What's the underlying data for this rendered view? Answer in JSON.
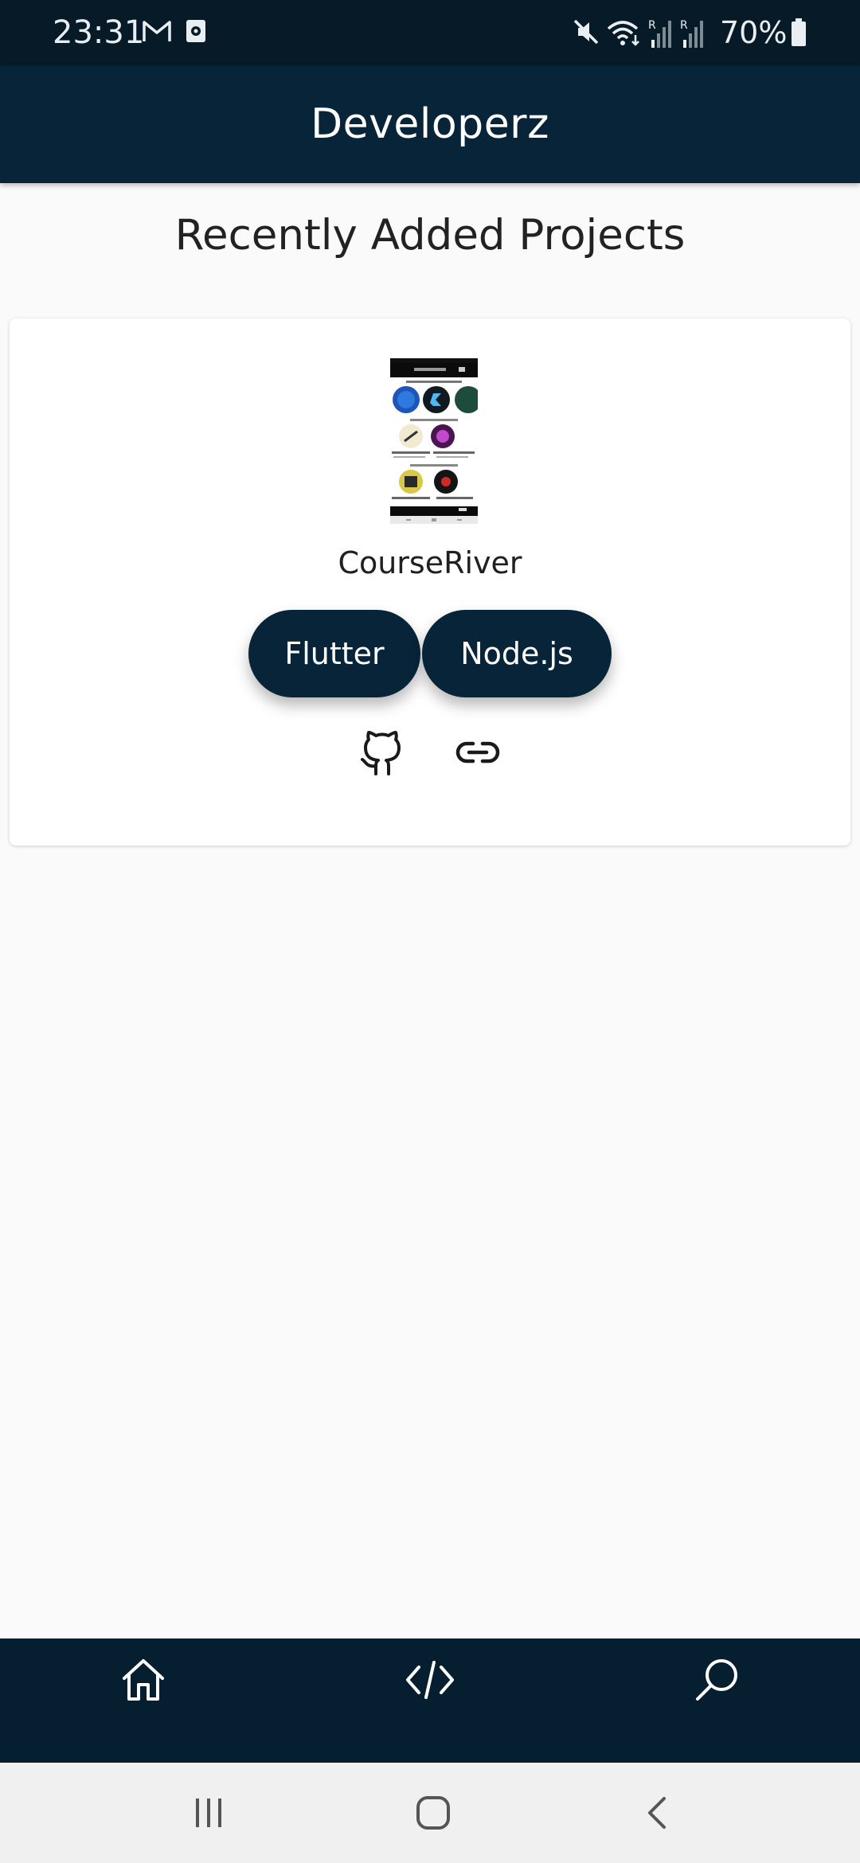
{
  "status_bar": {
    "time": "23:31",
    "battery": "70%",
    "left_icons": [
      "gmail-icon",
      "screen-recorder-icon"
    ],
    "right_icons": [
      "mute-icon",
      "wifi-icon",
      "signal-r-icon",
      "signal-r-icon",
      "battery-icon"
    ]
  },
  "app_bar": {
    "title": "Developerz"
  },
  "main": {
    "section_title": "Recently Added Projects",
    "projects": [
      {
        "name": "CourseRiver",
        "tags": [
          "Flutter",
          "Node.js"
        ],
        "links": [
          "github-icon",
          "link-icon"
        ]
      }
    ]
  },
  "bottom_nav": {
    "items": [
      "home-icon",
      "code-icon",
      "search-icon"
    ]
  },
  "system_nav": {
    "items": [
      "recents-icon",
      "home-button-icon",
      "back-icon"
    ]
  },
  "colors": {
    "primary": "#082438",
    "status_bar": "#061a28",
    "background": "#fafafa",
    "card": "#ffffff"
  }
}
